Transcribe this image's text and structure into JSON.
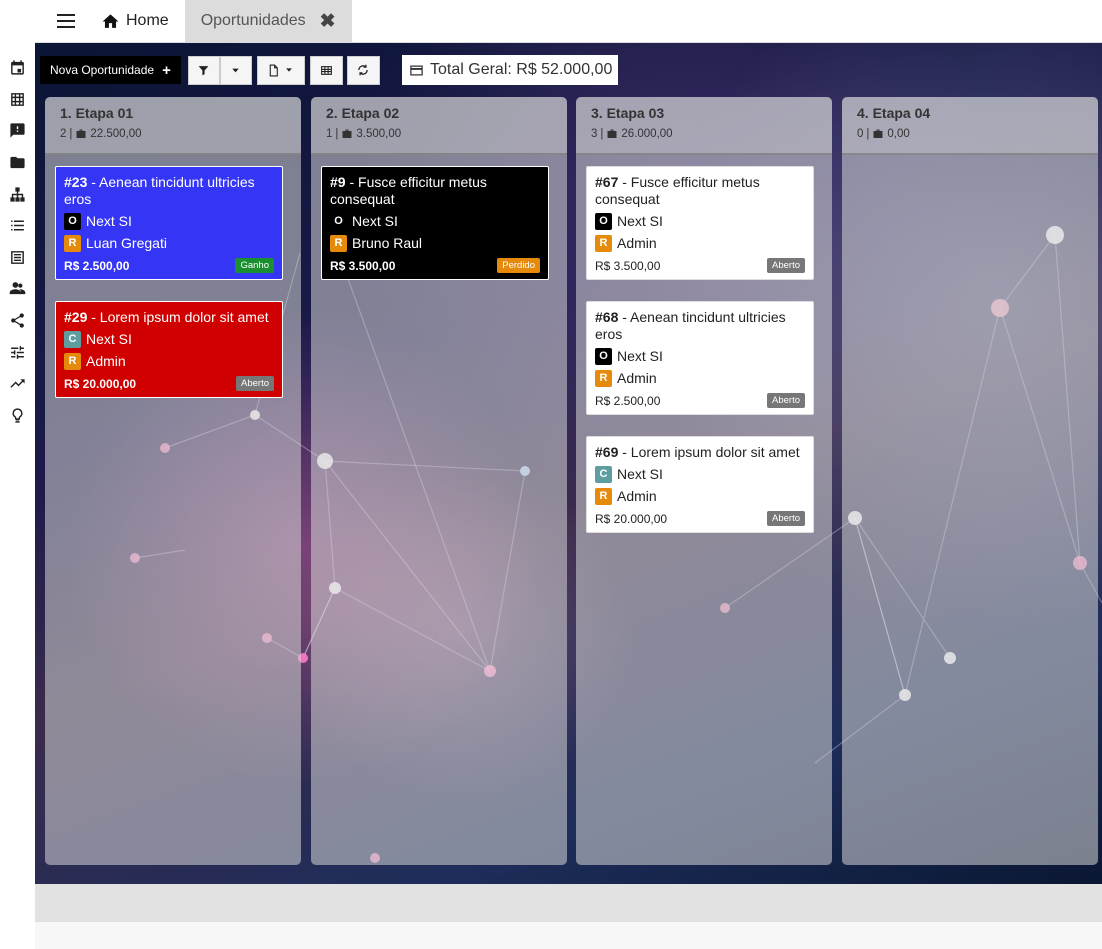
{
  "header": {
    "home_label": "Home",
    "active_tab_label": "Oportunidades"
  },
  "sidebar": {
    "icons": [
      "calendar-icon",
      "grid-icon",
      "feedback-icon",
      "folder-icon",
      "org-chart-icon",
      "list-icon",
      "table-icon",
      "people-icon",
      "share-icon",
      "tune-icon",
      "trending-icon",
      "bulb-icon"
    ]
  },
  "toolbar": {
    "new_label": "Nova Oportunidade",
    "total_label": "Total Geral: R$ 52.000,00"
  },
  "columns": [
    {
      "title": "1. Etapa 01",
      "count": "2",
      "sum": "22.500,00",
      "cards": [
        {
          "id": "#23",
          "title": " - Aenean tincidunt ultricies eros",
          "org_badge": "O",
          "org": "Next SI",
          "resp": "Luan Gregati",
          "value": "R$ 2.500,00",
          "status": "Ganho"
        },
        {
          "id": "#29",
          "title": " - Lorem ipsum dolor sit amet",
          "org_badge": "C",
          "org": "Next SI",
          "resp": "Admin",
          "value": "R$ 20.000,00",
          "status": "Aberto"
        }
      ]
    },
    {
      "title": "2. Etapa 02",
      "count": "1",
      "sum": "3.500,00",
      "cards": [
        {
          "id": "#9",
          "title": " - Fusce efficitur metus consequat",
          "org_badge": "O",
          "org": "Next SI",
          "resp": "Bruno Raul",
          "value": "R$ 3.500,00",
          "status": "Perdido"
        }
      ]
    },
    {
      "title": "3. Etapa 03",
      "count": "3",
      "sum": "26.000,00",
      "cards": [
        {
          "id": "#67",
          "title": " - Fusce efficitur metus consequat",
          "org_badge": "O",
          "org": "Next SI",
          "resp": "Admin",
          "value": "R$ 3.500,00",
          "status": "Aberto"
        },
        {
          "id": "#68",
          "title": " - Aenean tincidunt ultricies eros",
          "org_badge": "O",
          "org": "Next SI",
          "resp": "Admin",
          "value": "R$ 2.500,00",
          "status": "Aberto"
        },
        {
          "id": "#69",
          "title": " - Lorem ipsum dolor sit amet",
          "org_badge": "C",
          "org": "Next SI",
          "resp": "Admin",
          "value": "R$ 20.000,00",
          "status": "Aberto"
        }
      ]
    },
    {
      "title": "4. Etapa 04",
      "count": "0",
      "sum": "0,00",
      "cards": []
    }
  ],
  "resp_badge": "R"
}
